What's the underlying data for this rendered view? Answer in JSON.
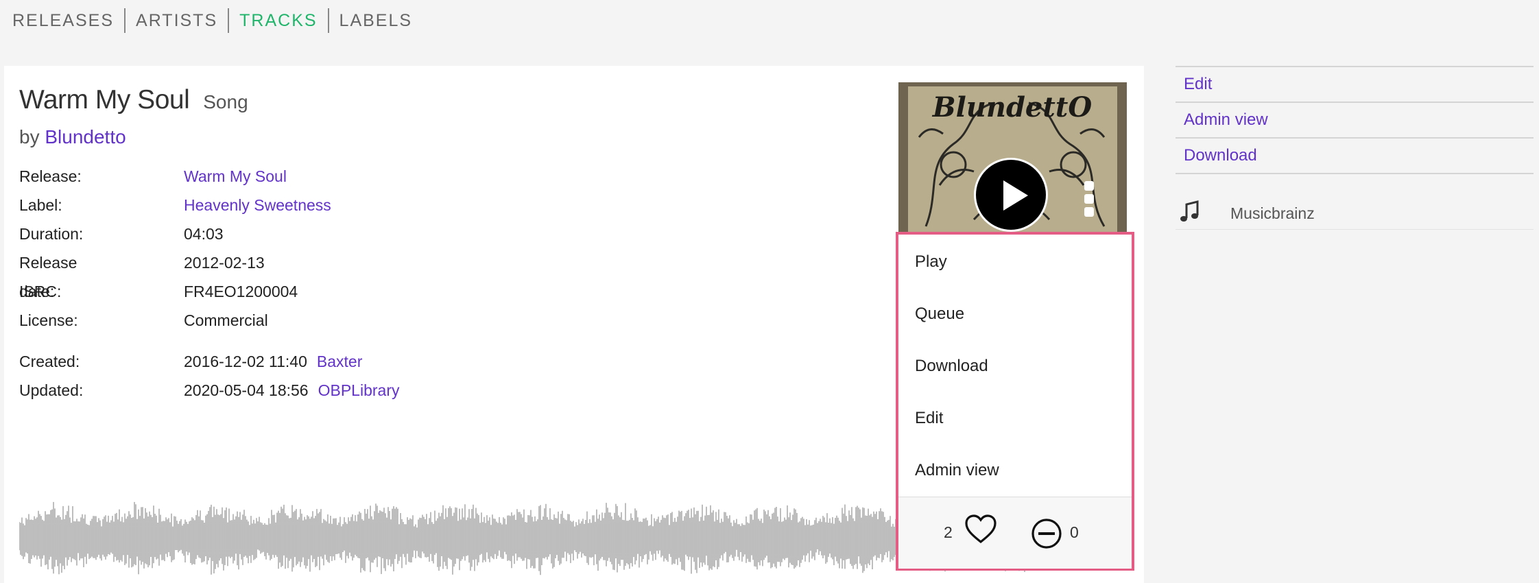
{
  "nav": {
    "items": [
      {
        "label": "RELEASES"
      },
      {
        "label": "ARTISTS"
      },
      {
        "label": "TRACKS"
      },
      {
        "label": "LABELS"
      }
    ],
    "active": "TRACKS"
  },
  "track": {
    "title": "Warm My Soul",
    "type": "Song",
    "by_prefix": "by",
    "artist": "Blundetto"
  },
  "meta": {
    "release_label": "Release:",
    "release_value": "Warm My Soul",
    "label_label": "Label:",
    "label_value": "Heavenly Sweetness",
    "duration_label": "Duration:",
    "duration_value": "04:03",
    "release_date_label": "Release date:",
    "release_date_value": "2012-02-13",
    "isrc_label": "ISRC:",
    "isrc_value": "FR4EO1200004",
    "license_label": "License:",
    "license_value": "Commercial",
    "created_label": "Created:",
    "created_value": "2016-12-02 11:40",
    "created_by": "Baxter",
    "updated_label": "Updated:",
    "updated_value": "2020-05-04 18:56",
    "updated_by": "OBPLibrary"
  },
  "cover": {
    "artist_text": "BlundettO"
  },
  "menu": {
    "play": "Play",
    "queue": "Queue",
    "download": "Download",
    "edit": "Edit",
    "admin_view": "Admin view",
    "likes": "2",
    "dislikes": "0"
  },
  "sidebar": {
    "edit": "Edit",
    "admin_view": "Admin view",
    "download": "Download",
    "external": "Musicbrainz"
  },
  "colors": {
    "link": "#6233c9",
    "nav_active": "#1fb56a",
    "menu_border": "#e35d84",
    "waveform": "#9a9a9a"
  },
  "icons": [
    "play-icon",
    "kebab-menu-icon",
    "heart-icon",
    "minus-circle-icon",
    "music-note-icon"
  ]
}
